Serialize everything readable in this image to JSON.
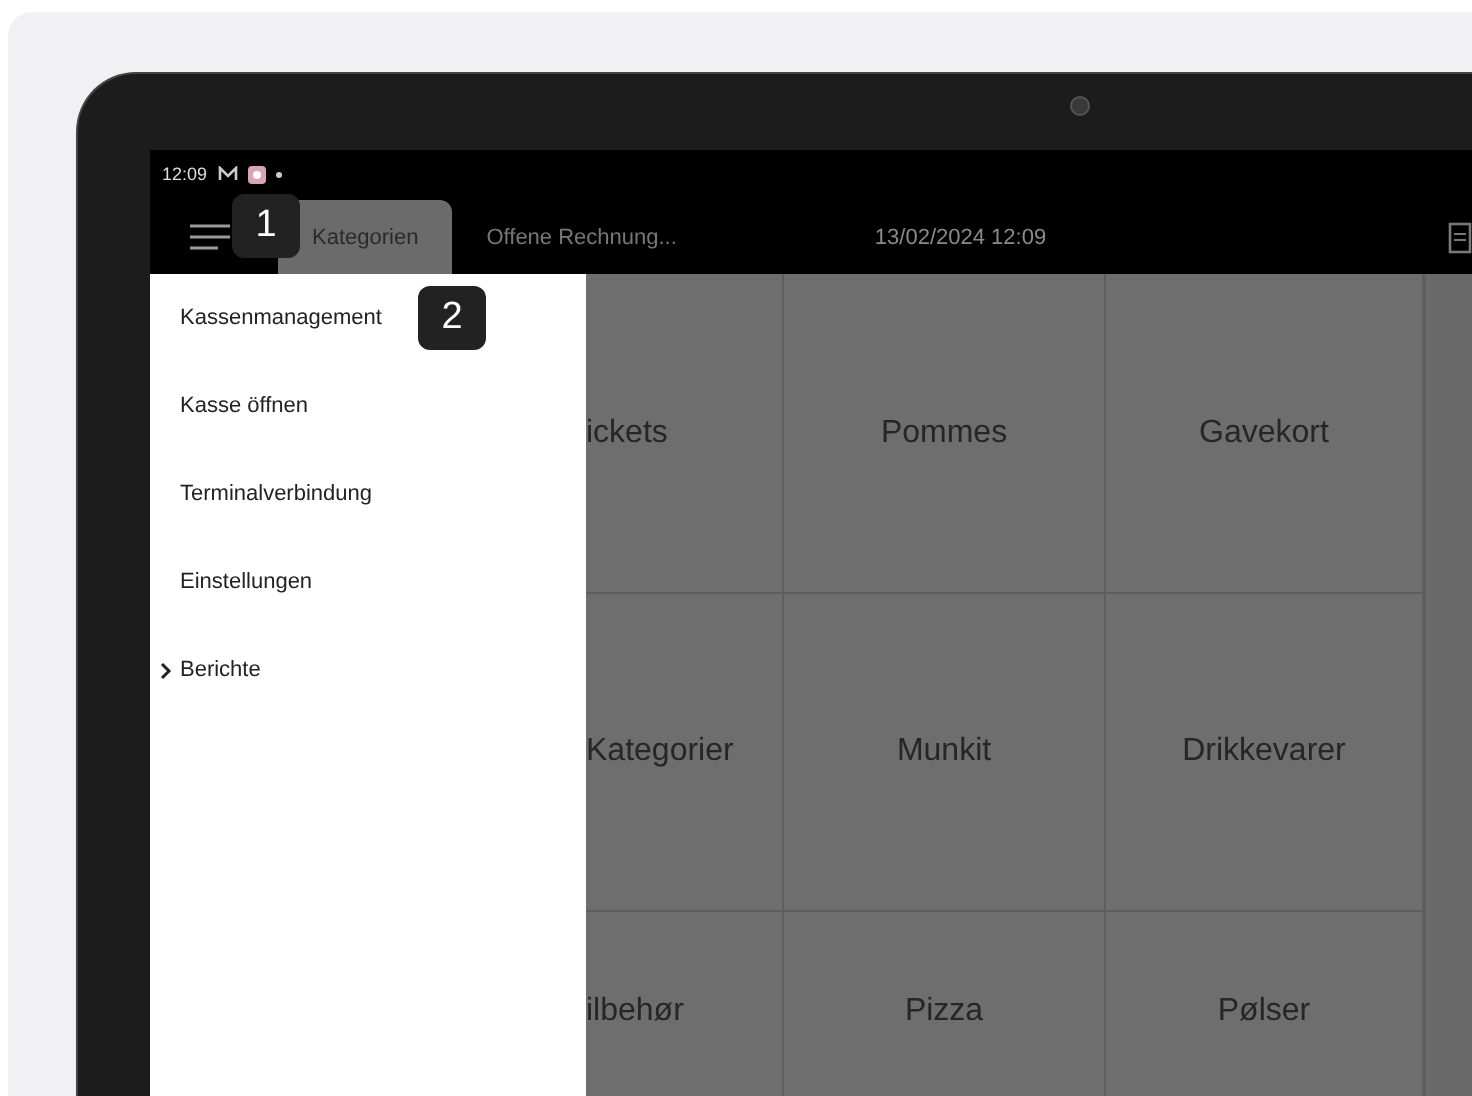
{
  "status_bar": {
    "time": "12:09"
  },
  "tabs": [
    {
      "label": "Kategorien",
      "selected": true
    },
    {
      "label": "Offene Rechnung...",
      "selected": false
    }
  ],
  "datetime": "13/02/2024 12:09",
  "drawer": {
    "items": [
      {
        "label": "Kassenmanagement",
        "kind": "item"
      },
      {
        "label": "Kasse öffnen",
        "kind": "item"
      },
      {
        "label": "Terminalverbindung",
        "kind": "item"
      },
      {
        "label": "Einstellungen",
        "kind": "item"
      },
      {
        "label": "Berichte",
        "kind": "group"
      }
    ]
  },
  "tiles": [
    [
      "ickets",
      "Pommes",
      "Gavekort"
    ],
    [
      "Kategorier",
      "Munkit",
      "Drikkevarer"
    ],
    [
      "ilbehør",
      "Pizza",
      "Pølser"
    ]
  ],
  "callouts": [
    {
      "label": "1"
    },
    {
      "label": "2"
    }
  ]
}
